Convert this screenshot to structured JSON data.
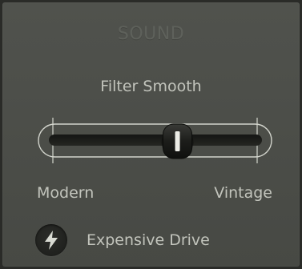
{
  "section": {
    "title": "SOUND"
  },
  "filter_smooth": {
    "label": "Filter Smooth",
    "min_label": "Modern",
    "max_label": "Vintage",
    "value": 0.61
  },
  "drive_toggle": {
    "label": "Expensive Drive",
    "icon": "lightning-bolt-icon",
    "enabled": false
  }
}
